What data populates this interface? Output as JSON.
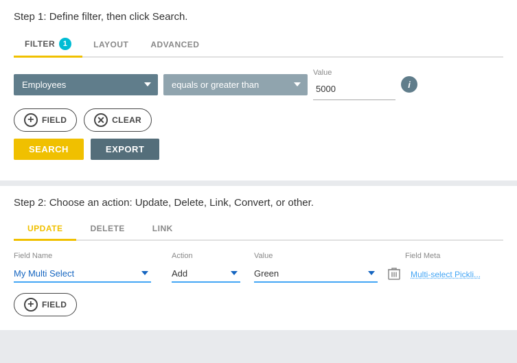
{
  "step1": {
    "title": "Step 1: Define filter, then click Search.",
    "tabs": [
      {
        "id": "filter",
        "label": "FILTER",
        "active": true,
        "badge": "1"
      },
      {
        "id": "layout",
        "label": "LAYOUT",
        "active": false,
        "badge": null
      },
      {
        "id": "advanced",
        "label": "ADVANCED",
        "active": false,
        "badge": null
      }
    ],
    "filter": {
      "field_label": "",
      "field_value": "Employees",
      "operator_label": "",
      "operator_value": "equals or greater than",
      "value_label": "Value",
      "value": "5000"
    },
    "buttons": {
      "add_field": "FIELD",
      "clear": "CLEAR",
      "search": "SEARCH",
      "export": "EXPORT"
    }
  },
  "step2": {
    "title": "Step 2: Choose an action: Update, Delete, Link, Convert, or other.",
    "tabs": [
      {
        "id": "update",
        "label": "UPDATE",
        "active": true
      },
      {
        "id": "delete",
        "label": "DELETE",
        "active": false
      },
      {
        "id": "link",
        "label": "LINK",
        "active": false
      }
    ],
    "table": {
      "headers": {
        "field_name": "Field Name",
        "action": "Action",
        "value": "Value",
        "field_meta": "Field Meta"
      },
      "rows": [
        {
          "field_name": "My Multi Select",
          "action": "Add",
          "value": "Green",
          "field_meta": "Multi-select Pickli..."
        }
      ]
    },
    "buttons": {
      "add_field": "FIELD"
    }
  }
}
